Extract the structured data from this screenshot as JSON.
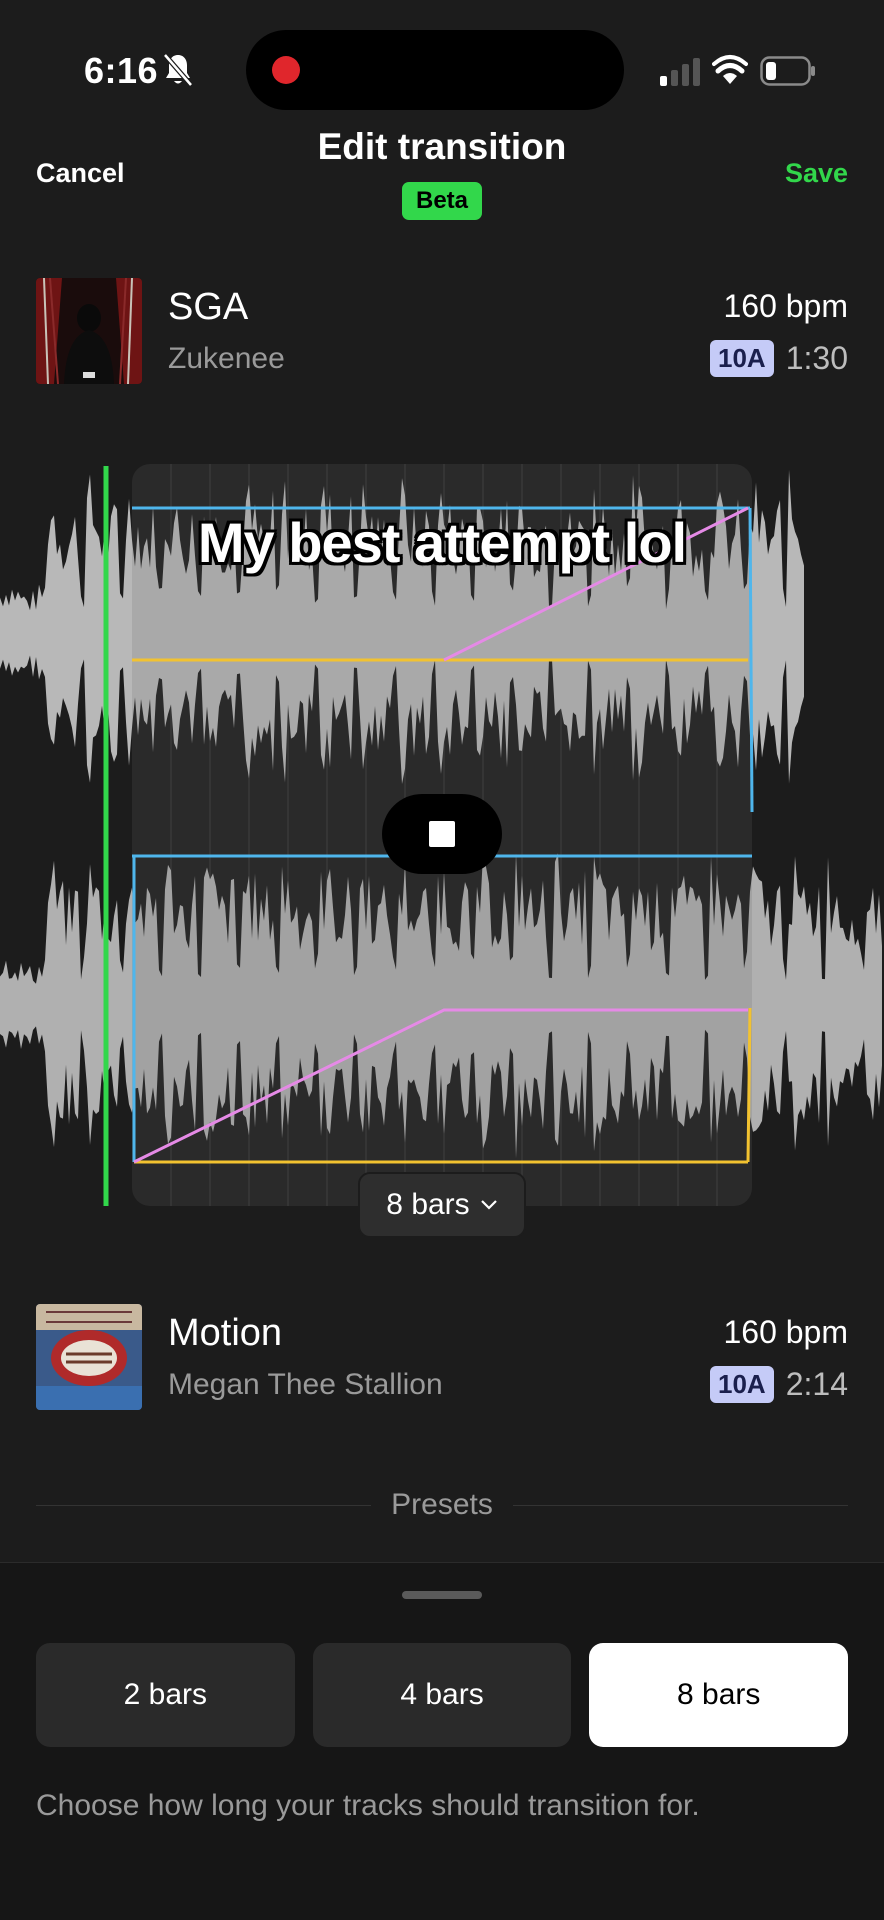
{
  "status_bar": {
    "time": "6:16"
  },
  "header": {
    "cancel_label": "Cancel",
    "title": "Edit transition",
    "badge": "Beta",
    "save_label": "Save"
  },
  "tracks": [
    {
      "name": "SGA",
      "artist": "Zukenee",
      "bpm": "160 bpm",
      "key": "10A",
      "duration": "1:30"
    },
    {
      "name": "Motion",
      "artist": "Megan Thee Stallion",
      "bpm": "160 bpm",
      "key": "10A",
      "duration": "2:14"
    }
  ],
  "editor": {
    "caption": "My best attempt lol",
    "length_label": "8 bars"
  },
  "presets": {
    "label": "Presets",
    "options": [
      "2 bars",
      "4 bars",
      "8 bars"
    ],
    "selected": "8 bars",
    "hint": "Choose how long your tracks should transition for."
  },
  "colors": {
    "accent": "#32d74b",
    "key_badge": "#c5cbf7",
    "low_line": "#4fb6ec",
    "mid_line": "#f2c230",
    "high_line": "#e58ae6"
  }
}
